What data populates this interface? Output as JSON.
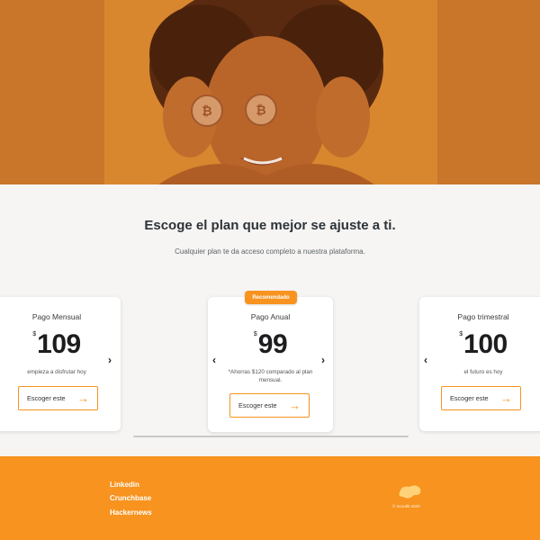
{
  "hero": {
    "image_alt": "person holding two bitcoin coins over eyes"
  },
  "plans_section": {
    "title": "Escoge el plan que mejor se ajuste a ti.",
    "subtitle": "Cualquier plan te da acceso completo a nuestra plataforma."
  },
  "badge": {
    "label": "Recomendado"
  },
  "plans": [
    {
      "name": "Pago Mensual",
      "currency": "$",
      "price": "109",
      "note": "empieza a disfrutar hoy",
      "button_label": "Escoger este"
    },
    {
      "name": "Pago Anual",
      "currency": "$",
      "price": "99",
      "note": "*Ahorras $120 comparado al plan mensual.",
      "button_label": "Escoger este"
    },
    {
      "name": "Pago trimestral",
      "currency": "$",
      "price": "100",
      "note": "el futuro es hoy",
      "button_label": "Escoger este"
    }
  ],
  "footer": {
    "links": [
      "Linkedin",
      "Crunchbase",
      "Hackernews"
    ],
    "copyright": "© Scoutlit 2020"
  },
  "colors": {
    "accent": "#f7931e",
    "hero_bg": "#c9762a",
    "section_bg": "#f6f5f3"
  },
  "icons": {
    "arrow": "arrow-right-icon",
    "chevron_left": "chevron-left-icon",
    "chevron_right": "chevron-right-icon",
    "logo": "brand-logo-icon"
  }
}
